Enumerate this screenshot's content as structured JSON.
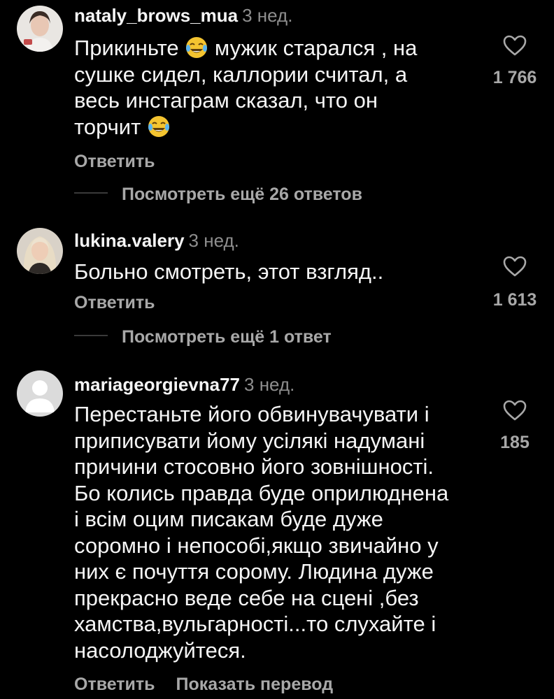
{
  "comments": [
    {
      "username": "nataly_brows_mua",
      "time": "3 нед.",
      "text_lines": [
        "Прикиньте",
        "мужик старался , на",
        "сушке сидел, каллории считал, а",
        "весь инстаграм сказал, что он",
        "торчит"
      ],
      "emoji": "tears-of-joy-emoji",
      "likes": "1 766",
      "reply_label": "Ответить",
      "view_replies": "Посмотреть ещё 26 ответов"
    },
    {
      "username": "lukina.valery",
      "time": "3 нед.",
      "text": "Больно смотреть, этот взгляд..",
      "likes": "1 613",
      "reply_label": "Ответить",
      "view_replies": "Посмотреть ещё 1 ответ"
    },
    {
      "username": "mariageorgievna77",
      "time": "3 нед.",
      "text": "Перестаньте його обвинувачувати і\nприписувати йому усілякі надумані\nпричини стосовно його зовнішності.\nБо колись правда буде оприлюднена\nі всім оцим писакам буде дуже\nсоромно і непособі,якщо звичайно у\nних є почуття сорому. Людина дуже\nпрекрасно веде себе на сцені ,без\nхамства,вульгарності...то слухайте і\nнасолоджуйтеся.",
      "likes": "185",
      "reply_label": "Ответить",
      "translate_label": "Показать перевод"
    }
  ],
  "colors": {
    "background": "#000000",
    "primary_text": "#f5f5f5",
    "secondary_text": "#a8a8a8",
    "time_text": "#8e8e8e"
  },
  "icons": {
    "like": "heart-outline-icon",
    "default_avatar": "default-avatar-icon"
  }
}
